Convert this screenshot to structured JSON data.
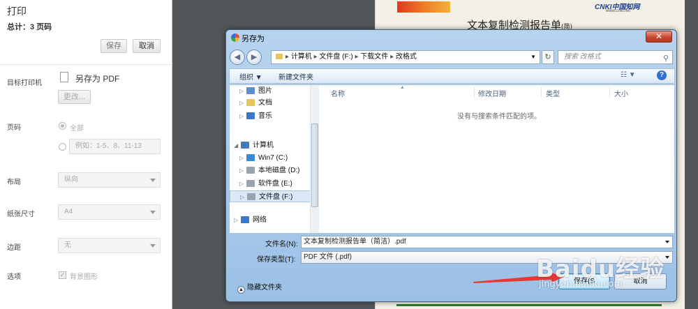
{
  "print_panel": {
    "title": "打印",
    "total": "总计：3 页码",
    "save_label": "保存",
    "cancel_label": "取消",
    "destination_label": "目标打印机",
    "destination_value": "另存为 PDF",
    "change_label": "更改...",
    "pages_label": "页码",
    "pages_all": "全部",
    "pages_placeholder": "例如：1-5、8、11-13",
    "layout_label": "布局",
    "layout_value": "纵向",
    "paper_label": "纸张尺寸",
    "paper_value": "A4",
    "margin_label": "边距",
    "margin_value": "无",
    "options_label": "选项",
    "options_bg": "背景图形"
  },
  "preview": {
    "report_title": "文本复制检测报告单",
    "report_title_suffix": "(简)",
    "cnki_logo": "CNKI中国知网",
    "cnki_sub": "www.cnki.net"
  },
  "dialog": {
    "title": "另存为",
    "close": "✕",
    "breadcrumb": [
      "计算机",
      "文件盘 (F:)",
      "下载文件",
      "改格式"
    ],
    "search_placeholder": "搜索 改格式",
    "organize": "组织 ▼",
    "new_folder": "新建文件夹",
    "tree": [
      {
        "label": "图片",
        "icon": "pictures-icon",
        "color": "#5b8fc8"
      },
      {
        "label": "文档",
        "icon": "documents-icon",
        "color": "#e8c55a"
      },
      {
        "label": "音乐",
        "icon": "music-icon",
        "color": "#3c78c8"
      },
      {
        "label": "计算机",
        "icon": "computer-icon",
        "color": "#4a7ab5"
      },
      {
        "label": "Win7 (C:)",
        "icon": "windows-drive-icon",
        "color": "#3a8ad6"
      },
      {
        "label": "本地磁盘 (D:)",
        "icon": "drive-icon",
        "color": "#9aa4ae"
      },
      {
        "label": "软件盘 (E:)",
        "icon": "drive-icon",
        "color": "#9aa4ae"
      },
      {
        "label": "文件盘 (F:)",
        "icon": "drive-icon",
        "color": "#9aa4ae"
      },
      {
        "label": "网络",
        "icon": "network-icon",
        "color": "#3c78c8"
      }
    ],
    "columns": [
      "名称",
      "修改日期",
      "类型",
      "大小"
    ],
    "empty_message": "没有与搜索条件匹配的项。",
    "filename_label": "文件名(N):",
    "filename_value": "文本复制检测报告单（简洁）.pdf",
    "filetype_label": "保存类型(T):",
    "filetype_value": "PDF 文件 (.pdf)",
    "hide_folders": "隐藏文件夹",
    "save_button": "保存(S",
    "cancel_button": "取消"
  },
  "watermark": {
    "text": "Baidu经验",
    "url": "jingyan.baidu.com"
  },
  "colors": {
    "arrow": "#e53935",
    "dialog_frame": "#9cc1e6",
    "close_button": "#c8482f"
  }
}
